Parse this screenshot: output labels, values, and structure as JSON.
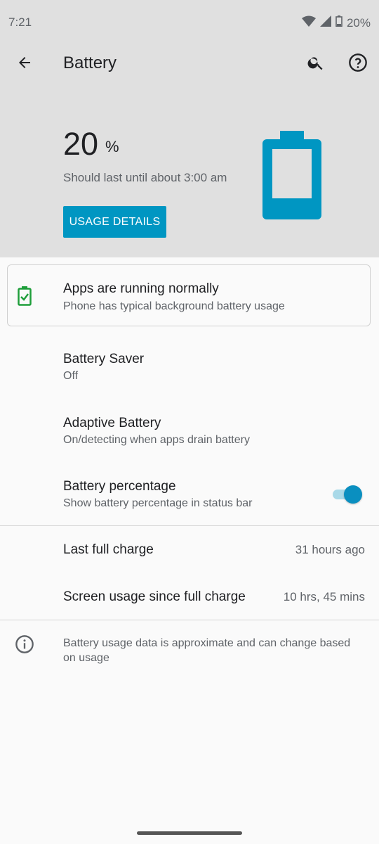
{
  "status_bar": {
    "time": "7:21",
    "battery_text": "20%"
  },
  "header": {
    "title": "Battery",
    "percent_value": "20",
    "percent_symbol": "%",
    "estimate": "Should last until about 3:00 am",
    "usage_button": "USAGE DETAILS",
    "battery_level_fraction": 0.2,
    "accent_color": "#0096c2"
  },
  "status_card": {
    "title": "Apps are running normally",
    "subtitle": "Phone has typical background battery usage",
    "icon": "battery-check-icon",
    "icon_color": "#1e9e3a"
  },
  "settings": {
    "battery_saver": {
      "title": "Battery Saver",
      "subtitle": "Off"
    },
    "adaptive_battery": {
      "title": "Adaptive Battery",
      "subtitle": "On/detecting when apps drain battery"
    },
    "battery_percentage": {
      "title": "Battery percentage",
      "subtitle": "Show battery percentage in status bar",
      "enabled": true
    }
  },
  "stats": {
    "last_full_charge": {
      "label": "Last full charge",
      "value": "31 hours ago"
    },
    "screen_usage": {
      "label": "Screen usage since full charge",
      "value": "10 hrs, 45 mins"
    }
  },
  "footer_note": "Battery usage data is approximate and can change based on usage"
}
